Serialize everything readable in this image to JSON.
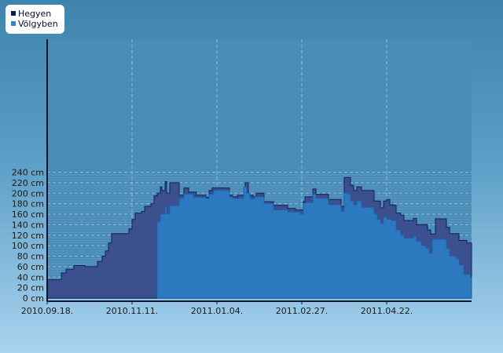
{
  "legend": {
    "series1_label": "Hegyen",
    "series2_label": "Völgyben"
  },
  "colors": {
    "hegyen_fill": "#3c4f8f",
    "hegyen_stroke": "#0e1f5a",
    "volgyben_fill": "#2d79c0",
    "volgyben_stroke": "#1a63ad",
    "plot_background": "#4a8cb6",
    "legend_hegyen": "#0a1a5a",
    "legend_volgyben": "#2d8ad0"
  },
  "chart_data": {
    "type": "area",
    "ylim": [
      0,
      240
    ],
    "yticks": [
      "0 cm",
      "20 cm",
      "40 cm",
      "60 cm",
      "80 cm",
      "100 cm",
      "120 cm",
      "140 cm",
      "160 cm",
      "180 cm",
      "200 cm",
      "220 cm",
      "240 cm"
    ],
    "xticks": [
      "2010.09.18.",
      "2010.11.11.",
      "2011.01.04.",
      "2011.02.27.",
      "2011.04.22."
    ],
    "grid": true,
    "legend_position": "top-left",
    "series": [
      {
        "name": "Hegyen",
        "points": [
          [
            "2010.09.18.",
            35
          ],
          [
            "2010.09.25.",
            35
          ],
          [
            "2010.09.27.",
            48
          ],
          [
            "2010.09.30.",
            55
          ],
          [
            "2010.10.03.",
            55
          ],
          [
            "2010.10.05.",
            62
          ],
          [
            "2010.10.10.",
            62
          ],
          [
            "2010.10.12.",
            60
          ],
          [
            "2010.10.18.",
            60
          ],
          [
            "2010.10.20.",
            70
          ],
          [
            "2010.10.23.",
            80
          ],
          [
            "2010.10.25.",
            90
          ],
          [
            "2010.10.27.",
            105
          ],
          [
            "2010.10.29.",
            123
          ],
          [
            "2010.11.07.",
            123
          ],
          [
            "2010.11.09.",
            132
          ],
          [
            "2010.11.11.",
            150
          ],
          [
            "2010.11.13.",
            162
          ],
          [
            "2010.11.17.",
            165
          ],
          [
            "2010.11.19.",
            175
          ],
          [
            "2010.11.23.",
            180
          ],
          [
            "2010.11.25.",
            195
          ],
          [
            "2010.11.27.",
            200
          ],
          [
            "2010.11.29.",
            212
          ],
          [
            "2010.11.30.",
            205
          ],
          [
            "2010.12.02.",
            222
          ],
          [
            "2010.12.03.",
            200
          ],
          [
            "2010.12.05.",
            220
          ],
          [
            "2010.12.09.",
            220
          ],
          [
            "2010.12.11.",
            196
          ],
          [
            "2010.12.14.",
            210
          ],
          [
            "2010.12.17.",
            202
          ],
          [
            "2010.12.20.",
            202
          ],
          [
            "2010.12.22.",
            196
          ],
          [
            "2010.12.26.",
            196
          ],
          [
            "2010.12.28.",
            192
          ],
          [
            "2010.12.30.",
            205
          ],
          [
            "2011.01.01.",
            210
          ],
          [
            "2011.01.10.",
            210
          ],
          [
            "2011.01.12.",
            196
          ],
          [
            "2011.01.14.",
            193
          ],
          [
            "2011.01.17.",
            196
          ],
          [
            "2011.01.20.",
            196
          ],
          [
            "2011.01.22.",
            220
          ],
          [
            "2011.01.24.",
            196
          ],
          [
            "2011.01.27.",
            193
          ],
          [
            "2011.01.29.",
            200
          ],
          [
            "2011.02.01.",
            200
          ],
          [
            "2011.02.03.",
            184
          ],
          [
            "2011.02.06.",
            184
          ],
          [
            "2011.02.09.",
            177
          ],
          [
            "2011.02.16.",
            177
          ],
          [
            "2011.02.18.",
            171
          ],
          [
            "2011.02.21.",
            171
          ],
          [
            "2011.02.23.",
            168
          ],
          [
            "2011.02.26.",
            168
          ],
          [
            "2011.02.28.",
            184
          ],
          [
            "2011.03.01.",
            193
          ],
          [
            "2011.03.04.",
            193
          ],
          [
            "2011.03.06.",
            208
          ],
          [
            "2011.03.08.",
            198
          ],
          [
            "2011.03.14.",
            198
          ],
          [
            "2011.03.16.",
            188
          ],
          [
            "2011.03.21.",
            188
          ],
          [
            "2011.03.24.",
            175
          ],
          [
            "2011.03.26.",
            230
          ],
          [
            "2011.03.28.",
            230
          ],
          [
            "2011.03.30.",
            215
          ],
          [
            "2011.04.01.",
            205
          ],
          [
            "2011.04.03.",
            212
          ],
          [
            "2011.04.06.",
            205
          ],
          [
            "2011.04.12.",
            205
          ],
          [
            "2011.04.14.",
            185
          ],
          [
            "2011.04.16.",
            185
          ],
          [
            "2011.04.18.",
            172
          ],
          [
            "2011.04.20.",
            185
          ],
          [
            "2011.04.22.",
            188
          ],
          [
            "2011.04.24.",
            178
          ],
          [
            "2011.04.26.",
            177
          ],
          [
            "2011.04.28.",
            162
          ],
          [
            "2011.05.01.",
            158
          ],
          [
            "2011.05.03.",
            148
          ],
          [
            "2011.05.07.",
            148
          ],
          [
            "2011.05.09.",
            152
          ],
          [
            "2011.05.11.",
            140
          ],
          [
            "2011.05.16.",
            140
          ],
          [
            "2011.05.18.",
            130
          ],
          [
            "2011.05.20.",
            122
          ],
          [
            "2011.05.23.",
            151
          ],
          [
            "2011.05.28.",
            151
          ],
          [
            "2011.05.30.",
            135
          ],
          [
            "2011.06.01.",
            123
          ],
          [
            "2011.06.05.",
            123
          ],
          [
            "2011.06.07.",
            110
          ],
          [
            "2011.06.10.",
            110
          ],
          [
            "2011.06.12.",
            105
          ],
          [
            "2011.06.15.",
            105
          ],
          [
            "2011.06.17.",
            85
          ],
          [
            "2011.06.21.",
            85
          ]
        ]
      },
      {
        "name": "Völgyben",
        "points": [
          [
            "2010.11.27.",
            0
          ],
          [
            "2010.11.27.",
            145
          ],
          [
            "2010.11.29.",
            160
          ],
          [
            "2010.12.01.",
            160
          ],
          [
            "2010.12.02.",
            175
          ],
          [
            "2010.12.03.",
            160
          ],
          [
            "2010.12.05.",
            176
          ],
          [
            "2010.12.09.",
            176
          ],
          [
            "2010.12.11.",
            190
          ],
          [
            "2010.12.14.",
            198
          ],
          [
            "2010.12.17.",
            198
          ],
          [
            "2010.12.20.",
            192
          ],
          [
            "2010.12.26.",
            192
          ],
          [
            "2010.12.28.",
            190
          ],
          [
            "2010.12.30.",
            198
          ],
          [
            "2011.01.02.",
            205
          ],
          [
            "2011.01.10.",
            205
          ],
          [
            "2011.01.12.",
            193
          ],
          [
            "2011.01.14.",
            190
          ],
          [
            "2011.01.19.",
            190
          ],
          [
            "2011.01.21.",
            212
          ],
          [
            "2011.01.23.",
            200
          ],
          [
            "2011.01.25.",
            189
          ],
          [
            "2011.01.28.",
            193
          ],
          [
            "2011.02.01.",
            193
          ],
          [
            "2011.02.03.",
            180
          ],
          [
            "2011.02.06.",
            180
          ],
          [
            "2011.02.09.",
            168
          ],
          [
            "2011.02.16.",
            168
          ],
          [
            "2011.02.18.",
            164
          ],
          [
            "2011.02.23.",
            164
          ],
          [
            "2011.02.26.",
            160
          ],
          [
            "2011.02.28.",
            180
          ],
          [
            "2011.03.01.",
            182
          ],
          [
            "2011.03.04.",
            182
          ],
          [
            "2011.03.06.",
            198
          ],
          [
            "2011.03.08.",
            190
          ],
          [
            "2011.03.14.",
            190
          ],
          [
            "2011.03.16.",
            178
          ],
          [
            "2011.03.21.",
            178
          ],
          [
            "2011.03.24.",
            165
          ],
          [
            "2011.03.26.",
            200
          ],
          [
            "2011.03.28.",
            198
          ],
          [
            "2011.03.30.",
            185
          ],
          [
            "2011.04.01.",
            178
          ],
          [
            "2011.04.03.",
            185
          ],
          [
            "2011.04.06.",
            173
          ],
          [
            "2011.04.12.",
            173
          ],
          [
            "2011.04.14.",
            160
          ],
          [
            "2011.04.16.",
            150
          ],
          [
            "2011.04.18.",
            142
          ],
          [
            "2011.04.20.",
            155
          ],
          [
            "2011.04.22.",
            150
          ],
          [
            "2011.04.25.",
            148
          ],
          [
            "2011.04.28.",
            130
          ],
          [
            "2011.05.01.",
            120
          ],
          [
            "2011.05.03.",
            114
          ],
          [
            "2011.05.07.",
            114
          ],
          [
            "2011.05.09.",
            118
          ],
          [
            "2011.05.11.",
            108
          ],
          [
            "2011.05.14.",
            100
          ],
          [
            "2011.05.17.",
            95
          ],
          [
            "2011.05.19.",
            85
          ],
          [
            "2011.05.21.",
            112
          ],
          [
            "2011.05.28.",
            112
          ],
          [
            "2011.05.30.",
            95
          ],
          [
            "2011.06.01.",
            80
          ],
          [
            "2011.06.05.",
            75
          ],
          [
            "2011.06.07.",
            63
          ],
          [
            "2011.06.10.",
            45
          ],
          [
            "2011.06.14.",
            40
          ],
          [
            "2011.06.17.",
            25
          ],
          [
            "2011.06.21.",
            25
          ],
          [
            "2011.06.21.",
            0
          ]
        ]
      }
    ]
  }
}
